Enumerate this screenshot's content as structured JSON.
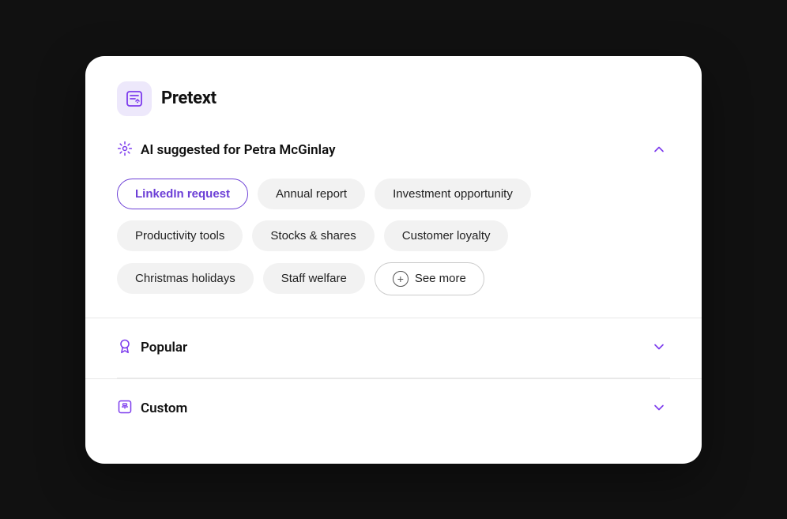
{
  "app": {
    "logo_label": "Pretext"
  },
  "ai_section": {
    "title": "AI suggested for Petra McGinlay",
    "tags_row1": [
      {
        "id": "linkedin",
        "label": "LinkedIn request",
        "active": true
      },
      {
        "id": "annual",
        "label": "Annual report",
        "active": false
      },
      {
        "id": "investment",
        "label": "Investment opportunity",
        "active": false
      }
    ],
    "tags_row2": [
      {
        "id": "productivity",
        "label": "Productivity tools",
        "active": false
      },
      {
        "id": "stocks",
        "label": "Stocks & shares",
        "active": false
      },
      {
        "id": "customer",
        "label": "Customer loyalty",
        "active": false
      }
    ],
    "tags_row3": [
      {
        "id": "christmas",
        "label": "Christmas holidays",
        "active": false
      },
      {
        "id": "staff",
        "label": "Staff welfare",
        "active": false
      },
      {
        "id": "see_more",
        "label": "See more",
        "active": false,
        "special": "see-more"
      }
    ],
    "chevron": "up"
  },
  "popular_section": {
    "title": "Popular",
    "chevron": "down"
  },
  "custom_section": {
    "title": "Custom",
    "chevron": "down"
  }
}
